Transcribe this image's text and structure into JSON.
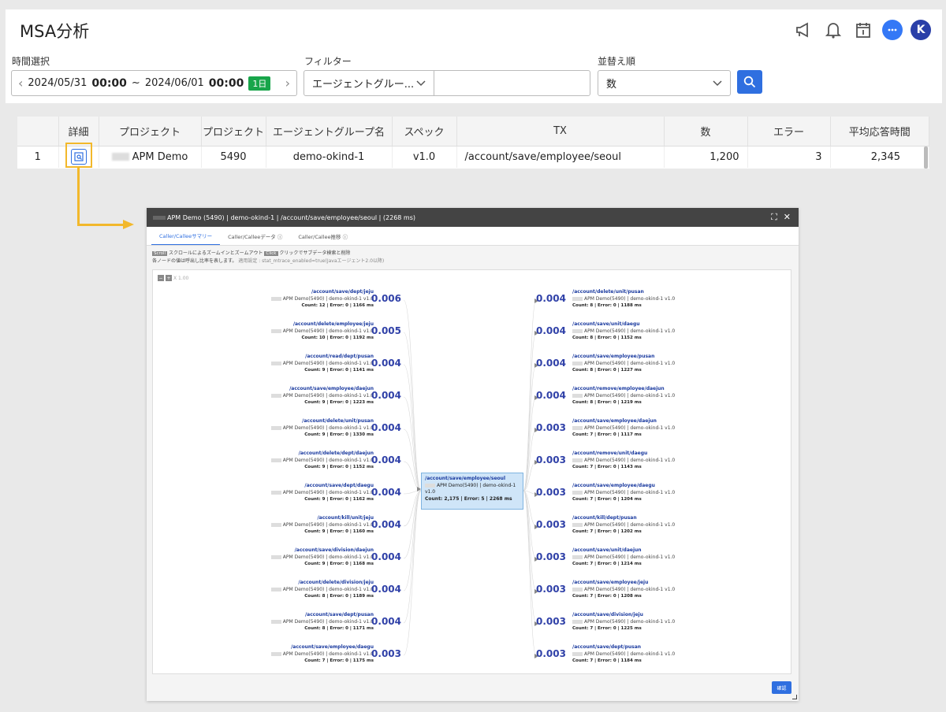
{
  "page": {
    "title": "MSA分析"
  },
  "icons": [
    "megaphone-icon",
    "bell-icon",
    "calendar-icon",
    "chat-icon",
    "user-avatar"
  ],
  "avatar_initial": "K",
  "filters": {
    "time_label": "時間選択",
    "date_start": "2024/05/31",
    "time_start": "00:00",
    "range_sep": "~",
    "date_end": "2024/06/01",
    "time_end": "00:00",
    "range_badge": "1日",
    "filter_label": "フィルター",
    "filter_value": "エージェントグルー...",
    "filter_input": "",
    "sort_label": "並替え順",
    "sort_value": "数"
  },
  "table": {
    "columns": [
      "",
      "詳細",
      "プロジェクト",
      "プロジェクト",
      "エージェントグループ名",
      "スペック",
      "TX",
      "数",
      "エラー",
      "平均応答時間"
    ],
    "rows": [
      {
        "index": "1",
        "project": "APM Demo",
        "project_code": "5490",
        "agent_group": "demo-okind-1",
        "spec": "v1.0",
        "tx": "/account/save/employee/seoul",
        "count": "1,200",
        "errors": "3",
        "avg_time": "2,345"
      }
    ]
  },
  "modal": {
    "title": "APM Demo (5490) | demo-okind-1 | /account/save/employee/seoul | (2268 ms)",
    "tabs": [
      "Caller/Calleeサマリー",
      "Caller/Calleeデータ",
      "Caller/Callee推移"
    ],
    "hint_scroll_key": "Scroll",
    "hint_scroll": "スクロールによるズームインとズームアウト",
    "hint_click_key": "Click",
    "hint_click": "クリックでサブデータ検索と削除",
    "hint_line2": "各ノードの値は呼出し比率を表します。",
    "hint_line2_muted": "適用設定 : stat_mtrace_enabled=true(Javaエージェント2.0以降)",
    "zoom_label": "X 1.00",
    "confirm": "確認",
    "center": {
      "path": "/account/save/employee/seoul",
      "app": "APM Demo(5490) | demo-okind-1 v1.0",
      "count": "Count: 2,175 | Error: 5 | 2268 ms"
    },
    "callers": [
      {
        "path": "/account/save/dept/jeju",
        "app": "APM Demo(5490) | demo-okind-1 v1.0",
        "count": "Count: 12 | Error: 0 | 1166 ms",
        "ratio": "0.006"
      },
      {
        "path": "/account/delete/employee/jeju",
        "app": "APM Demo(5490) | demo-okind-1 v1.0",
        "count": "Count: 10 | Error: 0 | 1192 ms",
        "ratio": "0.005"
      },
      {
        "path": "/account/read/dept/pusan",
        "app": "APM Demo(5490) | demo-okind-1 v1.0",
        "count": "Count: 9 | Error: 0 | 1141 ms",
        "ratio": "0.004"
      },
      {
        "path": "/account/save/employee/daejun",
        "app": "APM Demo(5490) | demo-okind-1 v1.0",
        "count": "Count: 9 | Error: 0 | 1223 ms",
        "ratio": "0.004"
      },
      {
        "path": "/account/delete/unit/pusan",
        "app": "APM Demo(5490) | demo-okind-1 v1.0",
        "count": "Count: 9 | Error: 0 | 1330 ms",
        "ratio": "0.004"
      },
      {
        "path": "/account/delete/dept/daejun",
        "app": "APM Demo(5490) | demo-okind-1 v1.0",
        "count": "Count: 9 | Error: 0 | 1152 ms",
        "ratio": "0.004"
      },
      {
        "path": "/account/save/dept/daegu",
        "app": "APM Demo(5490) | demo-okind-1 v1.0",
        "count": "Count: 9 | Error: 0 | 1162 ms",
        "ratio": "0.004"
      },
      {
        "path": "/account/kill/unit/jeju",
        "app": "APM Demo(5490) | demo-okind-1 v1.0",
        "count": "Count: 9 | Error: 0 | 1160 ms",
        "ratio": "0.004"
      },
      {
        "path": "/account/save/division/daejun",
        "app": "APM Demo(5490) | demo-okind-1 v1.0",
        "count": "Count: 9 | Error: 0 | 1168 ms",
        "ratio": "0.004"
      },
      {
        "path": "/account/delete/division/jeju",
        "app": "APM Demo(5490) | demo-okind-1 v1.0",
        "count": "Count: 8 | Error: 0 | 1189 ms",
        "ratio": "0.004"
      },
      {
        "path": "/account/save/dept/pusan",
        "app": "APM Demo(5490) | demo-okind-1 v1.0",
        "count": "Count: 8 | Error: 0 | 1171 ms",
        "ratio": "0.004"
      },
      {
        "path": "/account/save/employee/daegu",
        "app": "APM Demo(5490) | demo-okind-1 v1.0",
        "count": "Count: 7 | Error: 0 | 1175 ms",
        "ratio": "0.003"
      }
    ],
    "callees": [
      {
        "path": "/account/delete/unit/pusan",
        "app": "APM Demo(5490) | demo-okind-1 v1.0",
        "count": "Count: 8 | Error: 0 | 1188 ms",
        "ratio": "0.004"
      },
      {
        "path": "/account/save/unit/daegu",
        "app": "APM Demo(5490) | demo-okind-1 v1.0",
        "count": "Count: 8 | Error: 0 | 1152 ms",
        "ratio": "0.004"
      },
      {
        "path": "/account/save/employee/pusan",
        "app": "APM Demo(5490) | demo-okind-1 v1.0",
        "count": "Count: 8 | Error: 0 | 1227 ms",
        "ratio": "0.004"
      },
      {
        "path": "/account/remove/employee/daejun",
        "app": "APM Demo(5490) | demo-okind-1 v1.0",
        "count": "Count: 8 | Error: 0 | 1219 ms",
        "ratio": "0.004"
      },
      {
        "path": "/account/save/employee/daejun",
        "app": "APM Demo(5490) | demo-okind-1 v1.0",
        "count": "Count: 7 | Error: 0 | 1117 ms",
        "ratio": "0.003"
      },
      {
        "path": "/account/remove/unit/daegu",
        "app": "APM Demo(5490) | demo-okind-1 v1.0",
        "count": "Count: 7 | Error: 0 | 1143 ms",
        "ratio": "0.003"
      },
      {
        "path": "/account/save/employee/daegu",
        "app": "APM Demo(5490) | demo-okind-1 v1.0",
        "count": "Count: 7 | Error: 0 | 1204 ms",
        "ratio": "0.003"
      },
      {
        "path": "/account/kill/dept/pusan",
        "app": "APM Demo(5490) | demo-okind-1 v1.0",
        "count": "Count: 7 | Error: 0 | 1202 ms",
        "ratio": "0.003"
      },
      {
        "path": "/account/save/unit/daejun",
        "app": "APM Demo(5490) | demo-okind-1 v1.0",
        "count": "Count: 7 | Error: 0 | 1214 ms",
        "ratio": "0.003"
      },
      {
        "path": "/account/save/employee/jeju",
        "app": "APM Demo(5490) | demo-okind-1 v1.0",
        "count": "Count: 7 | Error: 0 | 1208 ms",
        "ratio": "0.003"
      },
      {
        "path": "/account/save/division/jeju",
        "app": "APM Demo(5490) | demo-okind-1 v1.0",
        "count": "Count: 7 | Error: 0 | 1225 ms",
        "ratio": "0.003"
      },
      {
        "path": "/account/save/dept/pusan",
        "app": "APM Demo(5490) | demo-okind-1 v1.0",
        "count": "Count: 7 | Error: 0 | 1184 ms",
        "ratio": "0.003"
      }
    ]
  }
}
